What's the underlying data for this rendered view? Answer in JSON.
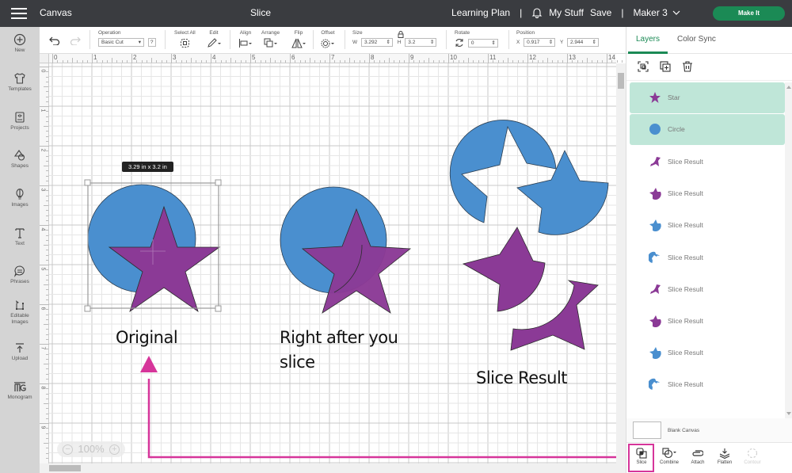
{
  "topbar": {
    "menu_icon": "hamburger-menu-icon",
    "left_title": "Canvas",
    "center_title": "Slice",
    "learning_plan": "Learning Plan",
    "separator": "|",
    "notifications_icon": "bell-icon",
    "my_stuff": "My Stuff",
    "save": "Save",
    "machine": "Maker 3",
    "machine_caret": "chevron-down-icon",
    "make_it": "Make It",
    "accent_color": "#1b8a55"
  },
  "sidebar": {
    "items": [
      {
        "label": "New",
        "icon": "plus-circle-icon"
      },
      {
        "label": "Templates",
        "icon": "shirt-icon"
      },
      {
        "label": "Projects",
        "icon": "projects-icon"
      },
      {
        "label": "Shapes",
        "icon": "shapes-icon"
      },
      {
        "label": "Images",
        "icon": "lightbulb-icon"
      },
      {
        "label": "Text",
        "icon": "text-icon"
      },
      {
        "label": "Phrases",
        "icon": "speech-bubble-icon"
      },
      {
        "label": "Editable",
        "label2": "Images",
        "icon": "editable-images-icon"
      },
      {
        "label": "Upload",
        "icon": "upload-icon"
      },
      {
        "label": "Monogram",
        "icon": "monogram-icon"
      }
    ]
  },
  "toolbar": {
    "undo_icon": "undo-icon",
    "redo_icon": "redo-icon",
    "operation_label": "Operation",
    "operation_value": "Basic Cut",
    "help": "?",
    "select_all_label": "Select All",
    "edit_label": "Edit",
    "align_label": "Align",
    "arrange_label": "Arrange",
    "flip_label": "Flip",
    "offset_label": "Offset",
    "size_label": "Size",
    "w_label": "W",
    "w_value": "3.292",
    "h_label": "H",
    "h_value": "3.2",
    "rotate_label": "Rotate",
    "rotate_value": "0",
    "position_label": "Position",
    "x_label": "X",
    "x_value": "0.917",
    "y_label": "Y",
    "y_value": "2.944"
  },
  "canvas": {
    "ruler_top": [
      "0",
      "1",
      "2",
      "3",
      "4",
      "5",
      "6",
      "7",
      "8",
      "9",
      "10",
      "11",
      "12",
      "13",
      "14"
    ],
    "ruler_left": [
      "0",
      "1",
      "2",
      "3",
      "4",
      "5",
      "6",
      "7",
      "8",
      "9"
    ],
    "zoom_level": "100%",
    "zoom_out": "−",
    "zoom_in": "+",
    "dimension_tooltip": "3.29  in x 3.2  in",
    "annotations": {
      "original": "Original",
      "right_after_line1": "Right after you",
      "right_after_line2": "slice",
      "slice_result": "Slice Result"
    },
    "colors": {
      "circle": "#4a8fcf",
      "star": "#8b3a96",
      "annotation_arrow": "#d6359a"
    }
  },
  "panel": {
    "tabs": [
      {
        "label": "Layers",
        "active": true
      },
      {
        "label": "Color Sync",
        "active": false
      }
    ],
    "actions": [
      "group-icon",
      "duplicate-icon",
      "delete-icon"
    ],
    "layers": [
      {
        "label": "Star",
        "selected": true,
        "thumb": "star",
        "color": "#8b3a96"
      },
      {
        "label": "Circle",
        "selected": true,
        "thumb": "circle",
        "color": "#4a8fcf"
      },
      {
        "label": "Slice Result",
        "selected": false,
        "thumb": "sliver",
        "color": "#8b3a96"
      },
      {
        "label": "Slice Result",
        "selected": false,
        "thumb": "star-cut",
        "color": "#8b3a96"
      },
      {
        "label": "Slice Result",
        "selected": false,
        "thumb": "star-cut",
        "color": "#4a8fcf"
      },
      {
        "label": "Slice Result",
        "selected": false,
        "thumb": "ring-cut",
        "color": "#4a8fcf"
      },
      {
        "label": "Slice Result",
        "selected": false,
        "thumb": "sliver",
        "color": "#8b3a96"
      },
      {
        "label": "Slice Result",
        "selected": false,
        "thumb": "star-cut",
        "color": "#8b3a96"
      },
      {
        "label": "Slice Result",
        "selected": false,
        "thumb": "star-cut",
        "color": "#4a8fcf"
      },
      {
        "label": "Slice Result",
        "selected": false,
        "thumb": "ring-cut",
        "color": "#4a8fcf"
      }
    ],
    "blank_canvas": "Blank Canvas",
    "bottom_tools": [
      {
        "label": "Slice",
        "icon": "slice-icon",
        "highlighted": true,
        "disabled": false
      },
      {
        "label": "Combine",
        "icon": "combine-icon",
        "highlighted": false,
        "disabled": false
      },
      {
        "label": "Attach",
        "icon": "attach-icon",
        "highlighted": false,
        "disabled": false
      },
      {
        "label": "Flatten",
        "icon": "flatten-icon",
        "highlighted": false,
        "disabled": false
      },
      {
        "label": "Contour",
        "icon": "contour-icon",
        "highlighted": false,
        "disabled": true
      }
    ]
  }
}
